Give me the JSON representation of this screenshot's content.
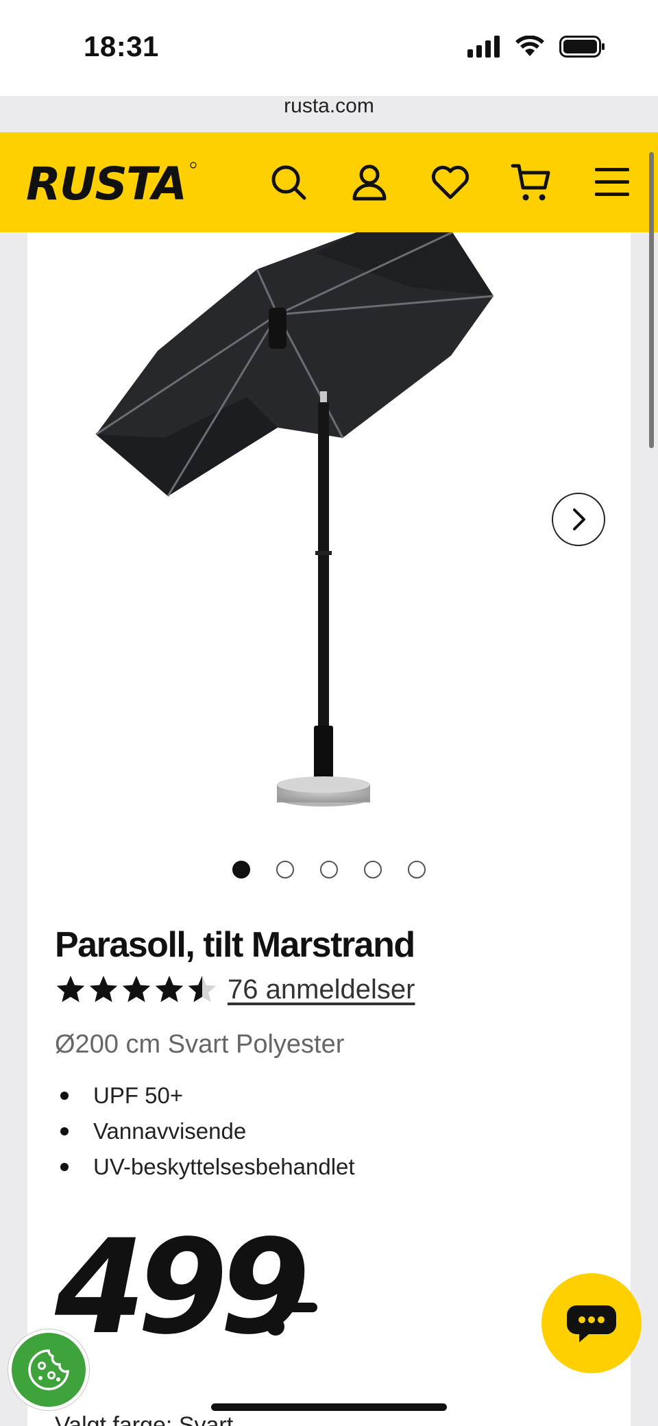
{
  "status_bar": {
    "time": "18:31",
    "url": "rusta.com"
  },
  "header": {
    "logo_text": "RUSTA",
    "icons": [
      "search-icon",
      "account-icon",
      "heart-icon",
      "cart-icon",
      "menu-icon"
    ],
    "background_color": "#fed000"
  },
  "gallery": {
    "image_count": 5,
    "active_index": 0,
    "next_icon": "chevron-right-icon"
  },
  "product": {
    "title": "Parasoll, tilt Marstrand",
    "rating": 4.5,
    "rating_max": 5,
    "reviews_label": "76 anmeldelser",
    "subtitle": "Ø200 cm Svart Polyester",
    "features": [
      "UPF 50+",
      "Vannavvisende",
      "UV-beskyttelsesbehandlet"
    ],
    "price": "499",
    "color_label": "Valgt farge:",
    "color_value": "Svart"
  },
  "floating": {
    "chat_icon": "chat-bubble-icon",
    "cookie_icon": "cookie-icon"
  }
}
